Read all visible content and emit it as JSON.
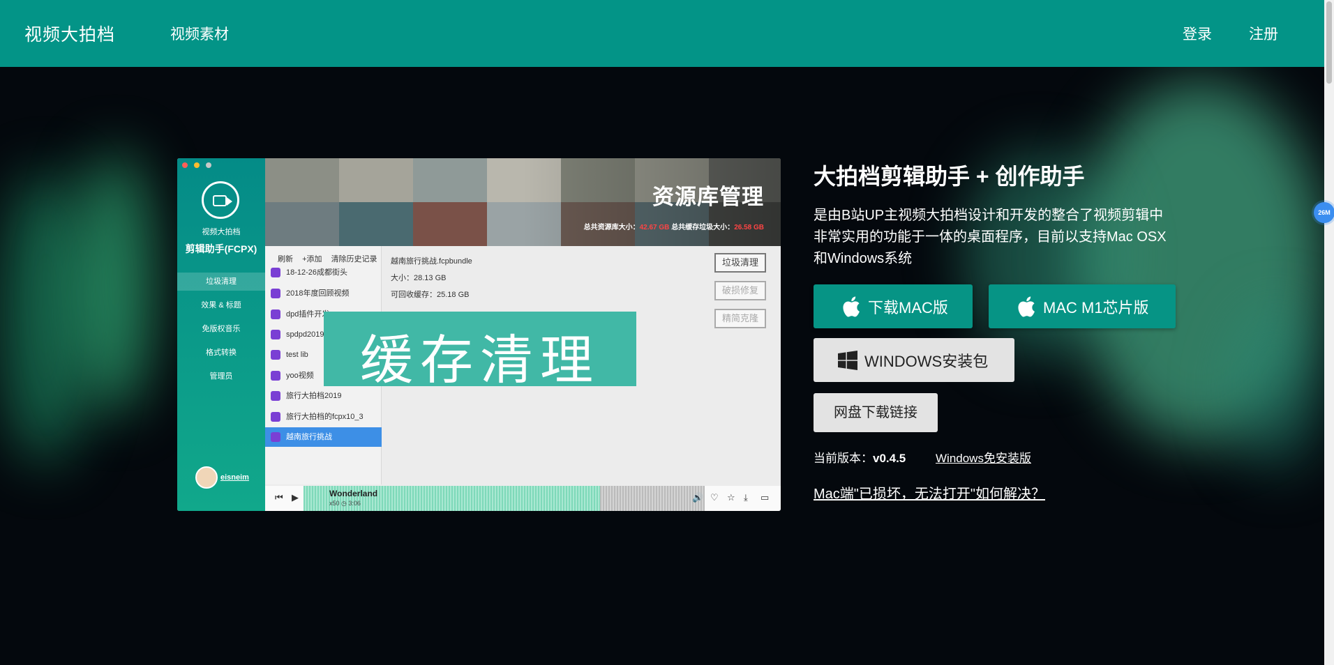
{
  "nav": {
    "brand": "视频大拍档",
    "links": [
      "视频素材"
    ],
    "login": "登录",
    "register": "注册"
  },
  "mock": {
    "sidebar_small_title": "视频大拍档",
    "sidebar_title": "剪辑助手(FCPX)",
    "menu": [
      "垃圾清理",
      "效果 & 标题",
      "免版权音乐",
      "格式转换",
      "管理员"
    ],
    "user": "eisneim",
    "banner_title": "资源库管理",
    "banner_stat_1_label": "总共资源库大小：",
    "banner_stat_1_value": "42.67 GB",
    "banner_stat_2_label": "总共缓存垃圾大小：",
    "banner_stat_2_value": "26.58 GB",
    "list_tools": [
      "刷新",
      "+添加",
      "清除历史记录"
    ],
    "list_items": [
      "18-12-26成都街头",
      "2018年度回顾视频",
      "dpd插件开发",
      "spdpd2019",
      "test lib",
      "yoo视频",
      "旅行大拍档2019",
      "旅行大拍档的fcpx10_3",
      "越南旅行挑战"
    ],
    "detail_name": "越南旅行挑战.fcpbundle",
    "detail_size": "大小：28.13 GB",
    "detail_clean": "可回收缓存：25.18 GB",
    "btn_clean": "垃圾清理",
    "btn_repair": "破损修复",
    "btn_clone": "精简克隆",
    "overlay_text": "缓存清理",
    "song_title": "Wonderland",
    "song_meta_1": "x50",
    "song_meta_2": "3:06"
  },
  "hero": {
    "title": "大拍档剪辑助手 + 创作助手",
    "description": "是由B站UP主视频大拍档设计和开发的整合了视频剪辑中非常实用的功能于一体的桌面程序，目前以支持Mac OSX和Windows系统",
    "btn_mac": "下载MAC版",
    "btn_m1": "MAC M1芯片版",
    "btn_windows": "WINDOWS安装包",
    "btn_netdisk": "网盘下载链接",
    "version_label": "当前版本：",
    "version_value": "v0.4.5",
    "windows_portable": "Windows免安装版",
    "mac_help": "Mac端\"已损坏，无法打开\"如何解决？"
  },
  "badge": "26M",
  "colors": {
    "primary": "#039487",
    "background": "#04080d",
    "button_light": "#e3e3e3"
  }
}
